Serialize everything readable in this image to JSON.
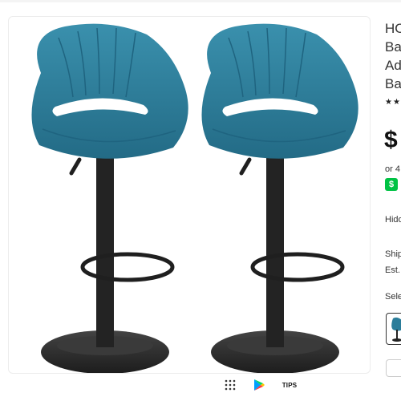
{
  "product": {
    "title_lines": [
      "HO",
      "Ba",
      "Ad",
      "Bas"
    ],
    "rating_stars": "★★",
    "price": "$",
    "installments_text": "or 4",
    "cashapp_badge": "$"
  },
  "info": {
    "hidden_text": "Hido",
    "shipping_text": "Ship",
    "estimate_text": "Est.",
    "select_label": "Sele"
  },
  "toolbar": {
    "tips_label": "TIPS"
  },
  "colors": {
    "seat_teal": "#2b7d9a",
    "metal_black": "#2a2a2a",
    "cashapp_green": "#00c244"
  }
}
